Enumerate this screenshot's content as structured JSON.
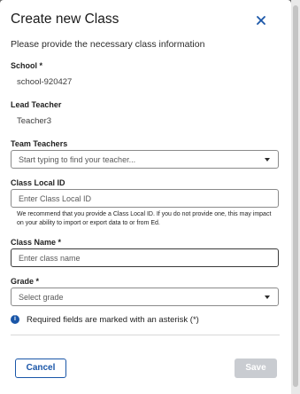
{
  "dialog": {
    "title": "Create new Class",
    "subtitle": "Please provide the necessary class information"
  },
  "school": {
    "label": "School *",
    "value": "school-920427"
  },
  "lead_teacher": {
    "label": "Lead Teacher",
    "value": "Teacher3"
  },
  "team_teachers": {
    "label": "Team Teachers",
    "placeholder": "Start typing to find your teacher..."
  },
  "class_local_id": {
    "label": "Class Local ID",
    "placeholder": "Enter Class Local ID",
    "help": "We recommend that you provide a Class Local ID. If you do not provide one, this may impact on your ability to import or export data to or from Ed."
  },
  "class_name": {
    "label": "Class Name *",
    "placeholder": "Enter class name"
  },
  "grade": {
    "label": "Grade *",
    "selected": "Select grade"
  },
  "info": {
    "text": "Required fields are marked with an asterisk (*)",
    "icon": "info-icon"
  },
  "actions": {
    "cancel_label": "Cancel",
    "save_label": "Save"
  },
  "colors": {
    "accent": "#1a56a8",
    "disabled": "#c9ccd1"
  }
}
